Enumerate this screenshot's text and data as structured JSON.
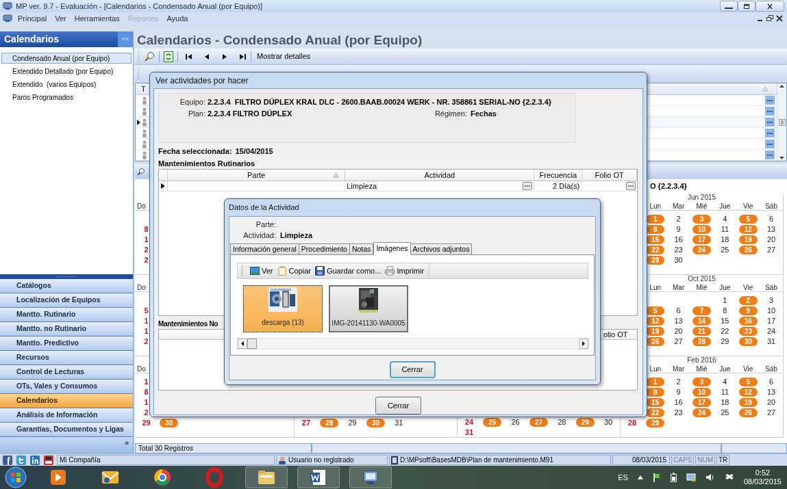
{
  "window": {
    "title": "MP ver. 9.7 - Evaluación - [Calendarios - Condensado Anual (por Equipo)]"
  },
  "menu": [
    {
      "label": "Principal",
      "disabled": false
    },
    {
      "label": "Ver",
      "disabled": false
    },
    {
      "label": "Herramientas",
      "disabled": false
    },
    {
      "label": "Reportes",
      "disabled": true
    },
    {
      "label": "Ayuda",
      "disabled": false
    }
  ],
  "sidebar": {
    "title": "Calendarios",
    "collapse": "<<",
    "more": "»",
    "items": [
      {
        "label": "Condensado Anual (por Equipo)",
        "selected": true
      },
      {
        "label": "Extendido Detallado (por Equipo)",
        "selected": false
      },
      {
        "label": "Extendido  (varios Equipos)",
        "selected": false
      },
      {
        "label": "Paros Programados",
        "selected": false
      }
    ],
    "nav": [
      {
        "label": "Catálogos",
        "selected": false
      },
      {
        "label": "Localización de Equipos",
        "selected": false
      },
      {
        "label": "Mantto. Rutinario",
        "selected": false
      },
      {
        "label": "Mantto. no Rutinario",
        "selected": false
      },
      {
        "label": "Mantto. Predictivo",
        "selected": false
      },
      {
        "label": "Recursos",
        "selected": false
      },
      {
        "label": "Control de Lecturas",
        "selected": false
      },
      {
        "label": "OTs, Vales y Consumos",
        "selected": false
      },
      {
        "label": "Calendarios",
        "selected": true
      },
      {
        "label": "Análisis de Información",
        "selected": false
      },
      {
        "label": "Garantías, Documentos y Ligas",
        "selected": false
      }
    ]
  },
  "page": {
    "title": "Calendarios - Condensado Anual (por Equipo)",
    "details_button": "Mostrar detalles",
    "equipment_grid": {
      "columns": [
        "T"
      ],
      "rows": [
        {
          "selected": false
        },
        {
          "selected": false
        },
        {
          "selected": true
        },
        {
          "selected": false
        },
        {
          "selected": false
        },
        {
          "selected": false
        }
      ]
    },
    "calendar_heading": "O {2.2.3.4}",
    "calendar_rows": [
      [
        {
          "headers": [
            "Do"
          ],
          "weeks": [
            [
              {
                "kind": "empty"
              }
            ],
            [
              {
                "day": "8",
                "kind": "sunday"
              }
            ],
            [
              {
                "day": "1",
                "kind": "sunday"
              }
            ],
            [
              {
                "day": "2",
                "kind": "sunday"
              }
            ],
            [
              {
                "day": "2",
                "kind": "sunday"
              }
            ]
          ]
        },
        {},
        {},
        {
          "title": "Jun 2015",
          "headers": [
            "Lun",
            "Mar",
            "Mié",
            "Jue",
            "Vie",
            "Sáb"
          ],
          "weeks": [
            [
              {
                "kind": "empty"
              },
              {
                "day": "1",
                "kind": "scheduled"
              },
              {
                "day": "2",
                "kind": "plain"
              },
              {
                "day": "3",
                "kind": "scheduled"
              },
              {
                "day": "4",
                "kind": "plain"
              },
              {
                "day": "5",
                "kind": "scheduled"
              },
              {
                "day": "6",
                "kind": "plain"
              }
            ],
            [
              {
                "kind": "empty"
              },
              {
                "day": "8",
                "kind": "scheduled"
              },
              {
                "day": "9",
                "kind": "plain"
              },
              {
                "day": "10",
                "kind": "scheduled"
              },
              {
                "day": "11",
                "kind": "plain"
              },
              {
                "day": "12",
                "kind": "scheduled"
              },
              {
                "day": "13",
                "kind": "plain"
              }
            ],
            [
              {
                "kind": "empty"
              },
              {
                "day": "15",
                "kind": "scheduled"
              },
              {
                "day": "16",
                "kind": "plain"
              },
              {
                "day": "17",
                "kind": "scheduled"
              },
              {
                "day": "18",
                "kind": "plain"
              },
              {
                "day": "19",
                "kind": "scheduled"
              },
              {
                "day": "20",
                "kind": "plain"
              }
            ],
            [
              {
                "kind": "empty"
              },
              {
                "day": "22",
                "kind": "scheduled"
              },
              {
                "day": "23",
                "kind": "plain"
              },
              {
                "day": "24",
                "kind": "scheduled"
              },
              {
                "day": "25",
                "kind": "plain"
              },
              {
                "day": "26",
                "kind": "scheduled"
              },
              {
                "day": "27",
                "kind": "plain"
              }
            ],
            [
              {
                "kind": "empty"
              },
              {
                "day": "29",
                "kind": "scheduled"
              },
              {
                "day": "30",
                "kind": "plain"
              }
            ]
          ]
        }
      ],
      [
        {
          "headers": [
            "Do"
          ],
          "weeks": [
            [
              {
                "kind": "empty"
              }
            ],
            [
              {
                "day": "5",
                "kind": "sunday"
              }
            ],
            [
              {
                "day": "1",
                "kind": "sunday"
              }
            ],
            [
              {
                "day": "1",
                "kind": "sunday"
              }
            ],
            [
              {
                "day": "2",
                "kind": "sunday"
              }
            ]
          ]
        },
        {},
        {},
        {
          "title": "Oct 2015",
          "headers": [
            "Lun",
            "Mar",
            "Mié",
            "Jue",
            "Vie",
            "Sáb"
          ],
          "weeks": [
            [
              {
                "kind": "empty"
              },
              {
                "kind": "empty"
              },
              {
                "kind": "empty"
              },
              {
                "kind": "empty"
              },
              {
                "day": "1",
                "kind": "plain"
              },
              {
                "day": "2",
                "kind": "scheduled"
              },
              {
                "day": "3",
                "kind": "plain"
              }
            ],
            [
              {
                "kind": "empty"
              },
              {
                "day": "5",
                "kind": "scheduled"
              },
              {
                "day": "6",
                "kind": "plain"
              },
              {
                "day": "7",
                "kind": "scheduled"
              },
              {
                "day": "8",
                "kind": "plain"
              },
              {
                "day": "9",
                "kind": "scheduled"
              },
              {
                "day": "10",
                "kind": "plain"
              }
            ],
            [
              {
                "kind": "empty"
              },
              {
                "day": "12",
                "kind": "scheduled"
              },
              {
                "day": "13",
                "kind": "plain"
              },
              {
                "day": "14",
                "kind": "scheduled"
              },
              {
                "day": "15",
                "kind": "plain"
              },
              {
                "day": "16",
                "kind": "scheduled"
              },
              {
                "day": "17",
                "kind": "plain"
              }
            ],
            [
              {
                "kind": "empty"
              },
              {
                "day": "19",
                "kind": "scheduled"
              },
              {
                "day": "20",
                "kind": "plain"
              },
              {
                "day": "21",
                "kind": "scheduled"
              },
              {
                "day": "22",
                "kind": "plain"
              },
              {
                "day": "23",
                "kind": "scheduled"
              },
              {
                "day": "24",
                "kind": "plain"
              }
            ],
            [
              {
                "kind": "empty"
              },
              {
                "day": "26",
                "kind": "scheduled"
              },
              {
                "day": "27",
                "kind": "plain"
              },
              {
                "day": "28",
                "kind": "scheduled"
              },
              {
                "day": "29",
                "kind": "plain"
              },
              {
                "day": "30",
                "kind": "scheduled"
              },
              {
                "day": "31",
                "kind": "plain"
              }
            ]
          ]
        }
      ],
      [
        {
          "headers": [
            "Do"
          ],
          "weeks": [
            [
              {
                "day": "1",
                "kind": "sunday"
              }
            ],
            [
              {
                "day": "8",
                "kind": "sunday"
              }
            ],
            [
              {
                "day": "1",
                "kind": "sunday"
              }
            ],
            [
              {
                "day": "2",
                "kind": "sunday"
              }
            ],
            [
              {
                "day": "29",
                "kind": "sunday"
              },
              {
                "day": "30",
                "kind": "scheduled"
              }
            ]
          ]
        },
        {
          "weeks": [
            [
              {
                "kind": "empty"
              }
            ],
            [
              {
                "kind": "empty"
              }
            ],
            [
              {
                "kind": "empty"
              }
            ],
            [
              {
                "kind": "empty"
              }
            ],
            [
              {
                "day": "27",
                "kind": "sunday"
              },
              {
                "day": "28",
                "kind": "scheduled"
              },
              {
                "day": "29",
                "kind": "plain"
              },
              {
                "day": "30",
                "kind": "scheduled"
              },
              {
                "day": "31",
                "kind": "plain"
              }
            ]
          ]
        },
        {
          "weeks": [
            [
              {
                "kind": "empty"
              }
            ],
            [
              {
                "kind": "empty"
              }
            ],
            [
              {
                "kind": "empty"
              }
            ],
            [
              {
                "kind": "empty"
              }
            ],
            [
              {
                "day": "24",
                "kind": "sunday"
              },
              {
                "day": "25",
                "kind": "scheduled"
              },
              {
                "day": "26",
                "kind": "plain"
              },
              {
                "day": "27",
                "kind": "scheduled"
              },
              {
                "day": "28",
                "kind": "plain"
              },
              {
                "day": "29",
                "kind": "scheduled"
              },
              {
                "day": "30",
                "kind": "plain"
              }
            ],
            [
              {
                "day": "31",
                "kind": "sunday"
              }
            ]
          ]
        },
        {
          "title": "Feb 2016",
          "headers": [
            "Lun",
            "Mar",
            "Mié",
            "Jue",
            "Vie",
            "Sáb"
          ],
          "weeks": [
            [
              {
                "kind": "empty"
              },
              {
                "day": "1",
                "kind": "scheduled"
              },
              {
                "day": "2",
                "kind": "plain"
              },
              {
                "day": "3",
                "kind": "scheduled"
              },
              {
                "day": "4",
                "kind": "plain"
              },
              {
                "day": "5",
                "kind": "scheduled"
              },
              {
                "day": "6",
                "kind": "plain"
              }
            ],
            [
              {
                "kind": "empty"
              },
              {
                "day": "8",
                "kind": "scheduled"
              },
              {
                "day": "9",
                "kind": "plain"
              },
              {
                "day": "10",
                "kind": "scheduled"
              },
              {
                "day": "11",
                "kind": "plain"
              },
              {
                "day": "12",
                "kind": "scheduled"
              },
              {
                "day": "13",
                "kind": "plain"
              }
            ],
            [
              {
                "kind": "empty"
              },
              {
                "day": "15",
                "kind": "scheduled"
              },
              {
                "day": "16",
                "kind": "plain"
              },
              {
                "day": "17",
                "kind": "scheduled"
              },
              {
                "day": "18",
                "kind": "plain"
              },
              {
                "day": "19",
                "kind": "scheduled"
              },
              {
                "day": "20",
                "kind": "plain"
              }
            ],
            [
              {
                "kind": "empty"
              },
              {
                "day": "22",
                "kind": "scheduled"
              },
              {
                "day": "23",
                "kind": "plain"
              },
              {
                "day": "24",
                "kind": "scheduled"
              },
              {
                "day": "25",
                "kind": "plain"
              },
              {
                "day": "26",
                "kind": "scheduled"
              },
              {
                "day": "27",
                "kind": "plain"
              }
            ],
            [
              {
                "day": "28",
                "kind": "sunday"
              },
              {
                "day": "29",
                "kind": "scheduled"
              }
            ]
          ]
        }
      ]
    ],
    "records": "Total 30 Registros"
  },
  "status_bar": {
    "company": "Mi Compañía",
    "user": "Usuario no registrado",
    "path": "D:\\MPsoft\\BasesMDB\\Plan de mantenimiento.M91",
    "date": "08/03/2015",
    "indicators": [
      {
        "label": "CAPS",
        "on": false
      },
      {
        "label": "NUM",
        "on": false
      },
      {
        "label": "TR",
        "on": true
      }
    ]
  },
  "taskbar": {
    "language": "ES",
    "time": "0:52",
    "date": "08/03/2015"
  },
  "activities_dialog": {
    "title": "Ver actividades por hacer",
    "equipo_label": "Equipo:",
    "equipo": "2.2.3.4  FILTRO DÚPLEX KRAL DLC - 2600.BAAB.00024 WERK - NR. 358861 SERIAL-NO {2.2.3.4}",
    "plan_label": "Plan:",
    "plan": "2.2.3.4 FILTRO DÚPLEX",
    "regimen_label": "Régimen:",
    "regimen": "Fechas",
    "date_label": "Fecha seleccionada:",
    "date": "15/04/2015",
    "routine_heading": "Mantenimientos Rutinarios",
    "routine_table": {
      "columns": [
        "Parte",
        "Actividad",
        "Frecuencia",
        "Folio OT"
      ],
      "rows": [
        {
          "actividad": "Limpieza",
          "frecuencia": "2 Día(s)",
          "selected": true
        }
      ]
    },
    "nonroutine_heading": "Mantenimientos No",
    "nonroutine_table": {
      "columns": [
        "olio OT"
      ]
    },
    "close": "Cerrar"
  },
  "detail_dialog": {
    "title": "Datos de la Actividad",
    "parte_label": "Parte:",
    "actividad_label": "Actividad:",
    "actividad": "Limpieza",
    "tabs": [
      {
        "label": "Información general",
        "selected": false
      },
      {
        "label": "Procedimiento",
        "selected": false
      },
      {
        "label": "Notas",
        "selected": false
      },
      {
        "label": "Imágenes",
        "selected": true
      },
      {
        "label": "Archivos adjuntos",
        "selected": false
      }
    ],
    "toolbar": [
      {
        "label": "Ver",
        "kind": "view"
      },
      {
        "label": "Copiar",
        "kind": "copy"
      },
      {
        "label": "Guardar como...",
        "kind": "save"
      },
      {
        "label": "Imprimir",
        "kind": "print"
      }
    ],
    "images": [
      {
        "label": "descarga (13)",
        "selected": true
      },
      {
        "label": "IMG-20141130-WA0005",
        "selected": false
      }
    ],
    "close": "Cerrar"
  }
}
